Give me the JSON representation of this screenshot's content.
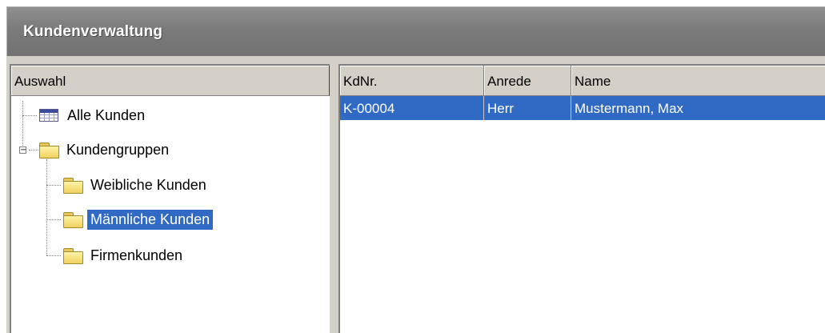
{
  "window": {
    "title": "Kundenverwaltung"
  },
  "tree": {
    "header": "Auswahl",
    "items": [
      {
        "label": "Alle Kunden",
        "icon": "table-icon"
      },
      {
        "label": "Kundengruppen",
        "icon": "folder-icon",
        "expanded": true,
        "expander": "−"
      },
      {
        "label": "Weibliche Kunden",
        "icon": "folder-icon"
      },
      {
        "label": "Männliche Kunden",
        "icon": "folder-icon",
        "selected": true
      },
      {
        "label": "Firmenkunden",
        "icon": "folder-icon"
      }
    ]
  },
  "grid": {
    "columns": [
      "KdNr.",
      "Anrede",
      "Name"
    ],
    "rows": [
      {
        "kdnr": "K-00004",
        "anrede": "Herr",
        "name": "Mustermann, Max",
        "selected": true
      }
    ]
  },
  "colors": {
    "selection": "#316ac5",
    "titlebar": "#7b7b7b",
    "panel": "#d4d0c8"
  }
}
